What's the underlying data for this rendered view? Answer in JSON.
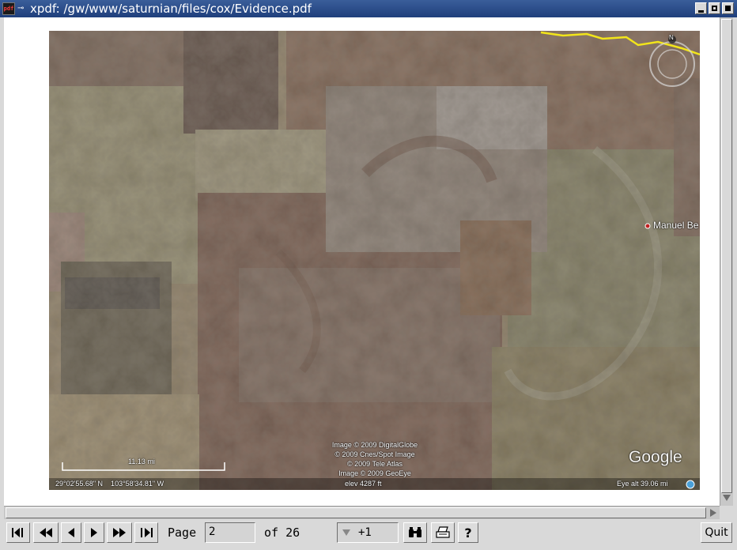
{
  "window": {
    "title": "xpdf: /gw/www/saturnian/files/cox/Evidence.pdf",
    "app_icon_text": "pdf",
    "buttons": [
      "iconify",
      "maximize",
      "close"
    ]
  },
  "map": {
    "place_label": "Manuel Be",
    "scale_text": "11.13 mi",
    "attribution": [
      "Image © 2009 DigitalGlobe",
      "© 2009 Cnes/Spot Image",
      "© 2009 Tele Atlas",
      "Image © 2009 GeoEye"
    ],
    "coords": "29°02'55.68\" N    103°58'34.81\" W",
    "elevation": "elev  4287 ft",
    "eye_alt": "Eye alt   39.06 mi",
    "logo": "Google",
    "compass_letter": "N",
    "colors": {
      "border_line": "#f2e51a",
      "terrain_dark": "#6e5a4e",
      "terrain_green": "#8b9474"
    }
  },
  "toolbar": {
    "page_label": "Page",
    "page_value": "2",
    "of_label": "of 26",
    "zoom_value": "+1",
    "quit_label": "Quit",
    "icons": [
      "first-page-icon",
      "back-5-icon",
      "prev-page-icon",
      "next-page-icon",
      "forward-5-icon",
      "last-page-icon",
      "find-icon",
      "print-icon",
      "help-icon"
    ],
    "help_label": "?"
  }
}
